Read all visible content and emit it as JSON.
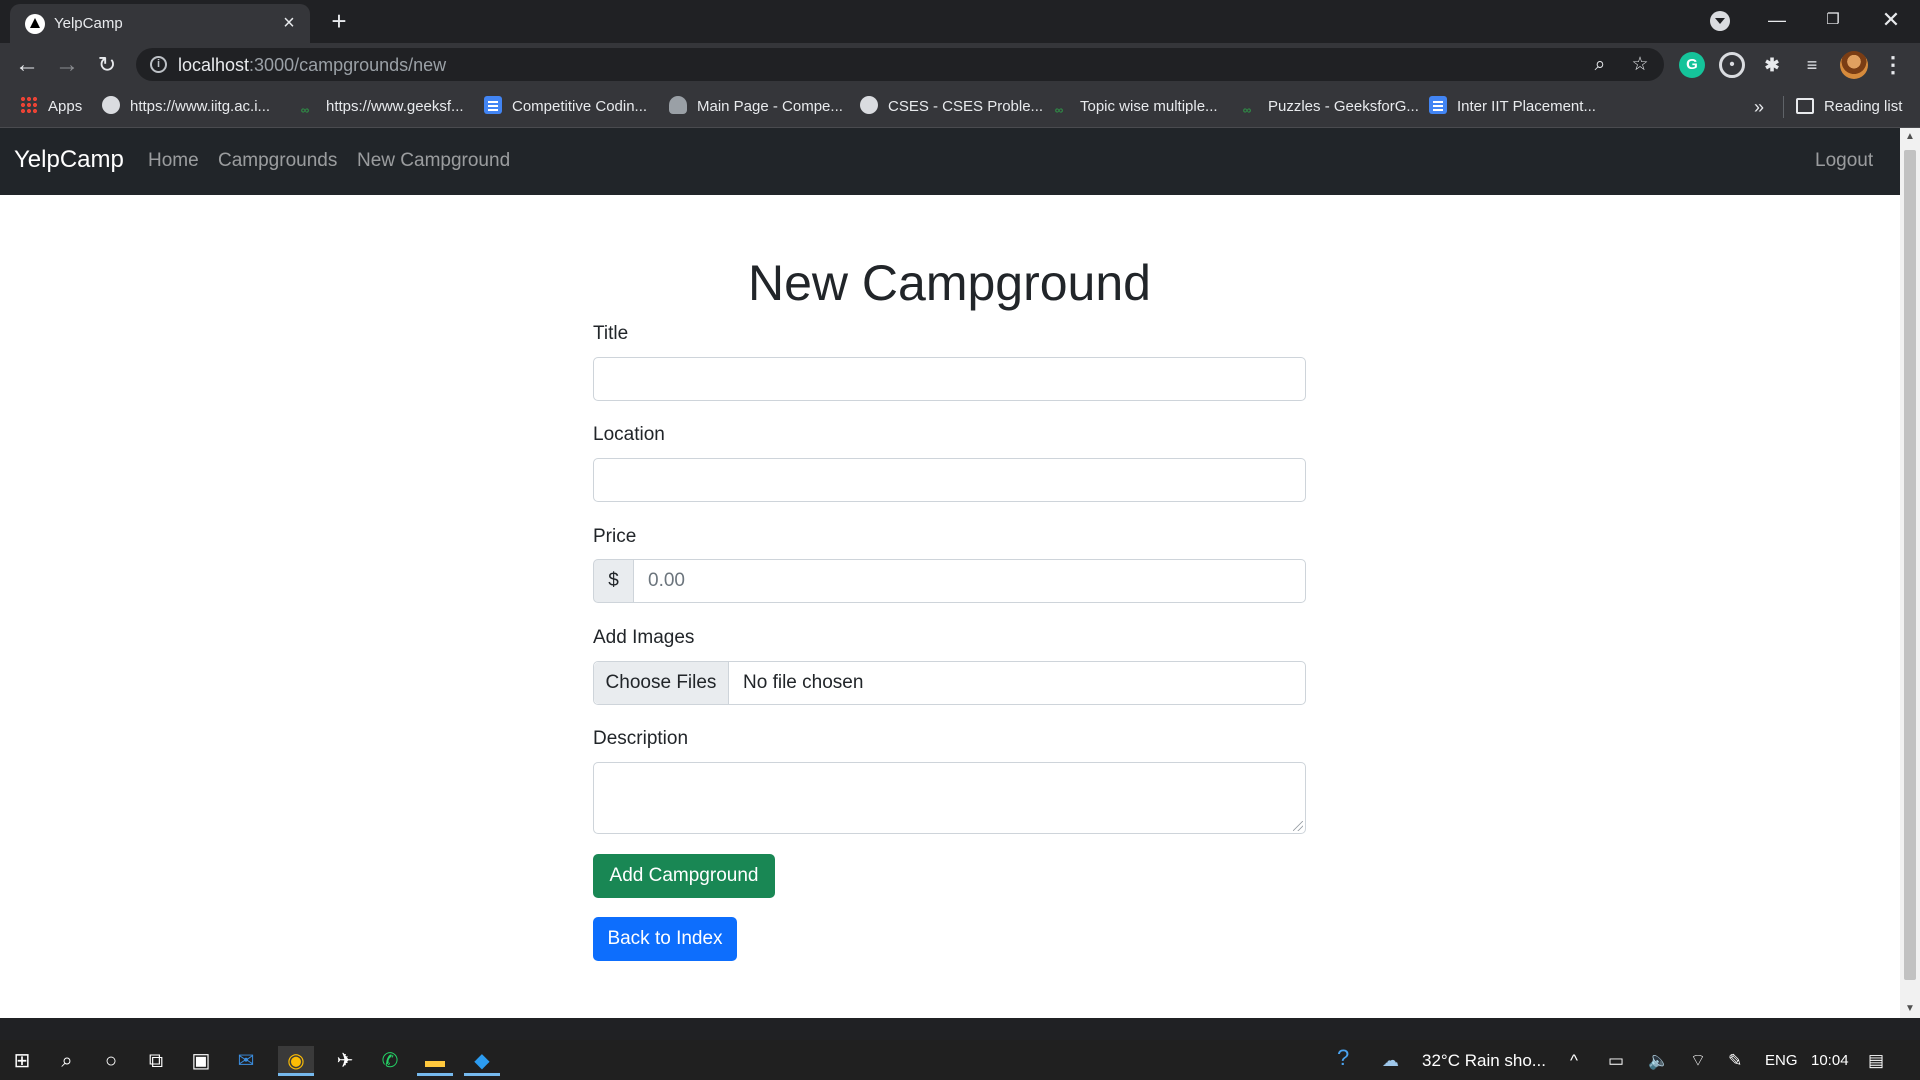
{
  "browser": {
    "tab_title": "YelpCamp",
    "url_host": "localhost",
    "url_path": ":3000/campgrounds/new",
    "bookmarks": [
      {
        "label": "Apps",
        "icon": "apps-grid-icon"
      },
      {
        "label": "https://www.iitg.ac.i...",
        "icon": "globe-icon"
      },
      {
        "label": "https://www.geeksf...",
        "icon": "gfg-icon"
      },
      {
        "label": "Competitive Codin...",
        "icon": "doc-icon"
      },
      {
        "label": "Main Page - Compe...",
        "icon": "pawn-icon"
      },
      {
        "label": "CSES - CSES Proble...",
        "icon": "globe-icon"
      },
      {
        "label": "Topic wise multiple...",
        "icon": "gfg-icon"
      },
      {
        "label": "Puzzles - GeeksforG...",
        "icon": "gfg-icon"
      },
      {
        "label": "Inter IIT Placement...",
        "icon": "doc-icon"
      }
    ],
    "reading_list": "Reading list"
  },
  "site_nav": {
    "brand": "YelpCamp",
    "links": [
      "Home",
      "Campgrounds",
      "New Campground"
    ],
    "logout": "Logout"
  },
  "form": {
    "heading": "New Campground",
    "title_label": "Title",
    "location_label": "Location",
    "price_label": "Price",
    "price_prefix": "$",
    "price_placeholder": "0.00",
    "images_label": "Add Images",
    "choose_files": "Choose Files",
    "no_file": "No file chosen",
    "description_label": "Description",
    "submit_label": "Add Campground",
    "back_label": "Back to Index"
  },
  "colors": {
    "navbar": "#212529",
    "success": "#198754",
    "primary": "#0d6efd"
  },
  "taskbar": {
    "weather": "32°C  Rain sho...",
    "language": "ENG",
    "time": "10:04"
  }
}
